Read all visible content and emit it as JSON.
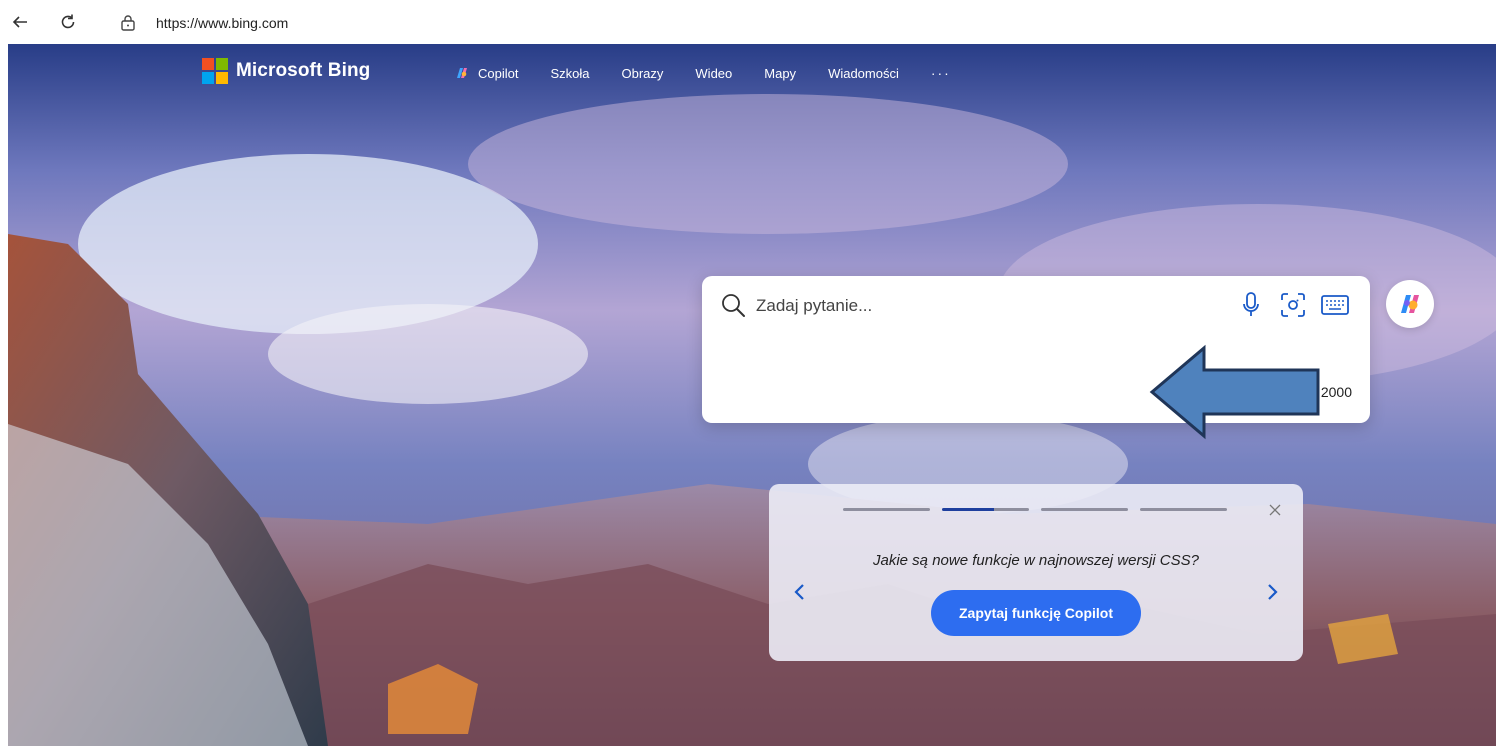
{
  "browser": {
    "url": "https://www.bing.com",
    "back_icon": "back-arrow-icon",
    "reload_icon": "reload-icon",
    "lock_icon": "lock-icon"
  },
  "header": {
    "brand": "Microsoft Bing",
    "nav": [
      {
        "label": "Copilot",
        "icon": "copilot-icon"
      },
      {
        "label": "Szkoła"
      },
      {
        "label": "Obrazy"
      },
      {
        "label": "Wideo"
      },
      {
        "label": "Mapy"
      },
      {
        "label": "Wiadomości"
      }
    ],
    "more": "···"
  },
  "search": {
    "placeholder": "Zadaj pytanie...",
    "counter": "2000",
    "icons": [
      "search-icon",
      "microphone-icon",
      "visual-search-icon",
      "keyboard-icon"
    ]
  },
  "suggestion_card": {
    "question": "Jakie są nowe funkcje w najnowszej wersji CSS?",
    "button_label": "Zapytaj funkcję Copilot",
    "page_count": 4,
    "active_index": 1
  },
  "colors": {
    "accent": "#2d6df0",
    "annotation_arrow": "#4f82bd"
  }
}
